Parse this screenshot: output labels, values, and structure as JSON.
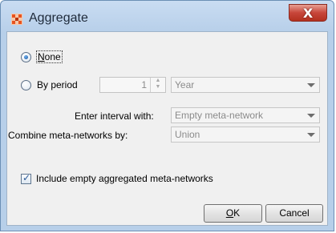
{
  "window": {
    "title": "Aggregate",
    "close_glyph": "X",
    "icon": "aggregate-app-icon"
  },
  "options": {
    "none_label_accel": "N",
    "none_label_rest": "one",
    "none_selected": true,
    "by_period_label": "By period",
    "by_period_selected": false,
    "period_value": "1",
    "period_unit": "Year"
  },
  "interval": {
    "label": "Enter interval with:",
    "value": "Empty meta-network"
  },
  "combine": {
    "label": "Combine meta-networks by:",
    "value": "Union"
  },
  "include_empty": {
    "label": "Include empty aggregated meta-networks",
    "checked": true,
    "check_glyph": "✓"
  },
  "buttons": {
    "ok_accel": "O",
    "ok_rest": "K",
    "cancel": "Cancel"
  },
  "colors": {
    "title_bar": "#c9dcf2",
    "close_button": "#c7463a",
    "dialog_bg": "#f0f0f0",
    "app_icon": "#e8531f"
  }
}
